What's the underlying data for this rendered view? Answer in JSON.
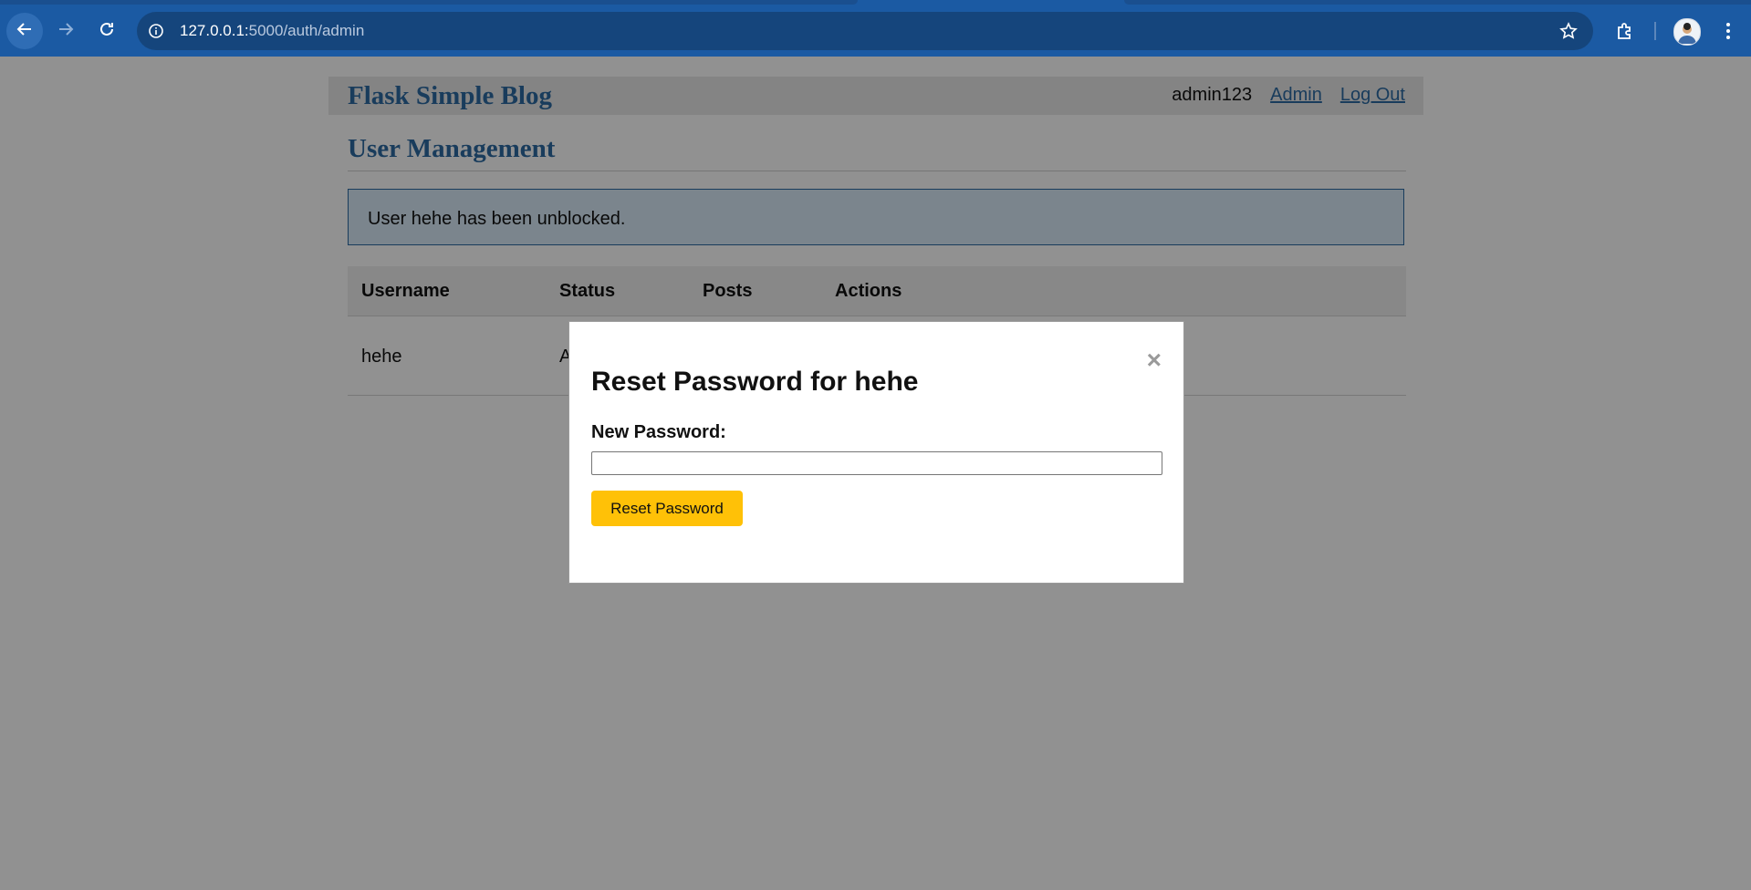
{
  "browser": {
    "url_host": "127.0.0.1:",
    "url_rest": "5000/auth/admin",
    "icons": [
      "back-icon",
      "forward-icon",
      "reload-icon",
      "site-info-icon",
      "bookmark-star-icon",
      "extensions-icon",
      "profile-avatar",
      "menu-kebab-icon"
    ]
  },
  "header": {
    "site_title": "Flask Simple Blog",
    "username": "admin123",
    "admin_link": "Admin",
    "logout_link": "Log Out"
  },
  "main": {
    "title": "User Management",
    "flash_message": "User hehe has been unblocked.",
    "table": {
      "columns": [
        "Username",
        "Status",
        "Posts",
        "Actions"
      ],
      "rows": [
        {
          "username": "hehe",
          "status": "A",
          "posts": "",
          "actions": ""
        }
      ]
    }
  },
  "modal": {
    "close_symbol": "×",
    "title": "Reset Password for hehe",
    "field_label": "New Password:",
    "field_value": "",
    "button_label": "Reset Password"
  },
  "colors": {
    "brand_blue": "#2c6aa3",
    "chrome_blue": "#1b5aa3",
    "button_yellow": "#ffc107",
    "flash_bg": "#d8eaf8"
  }
}
